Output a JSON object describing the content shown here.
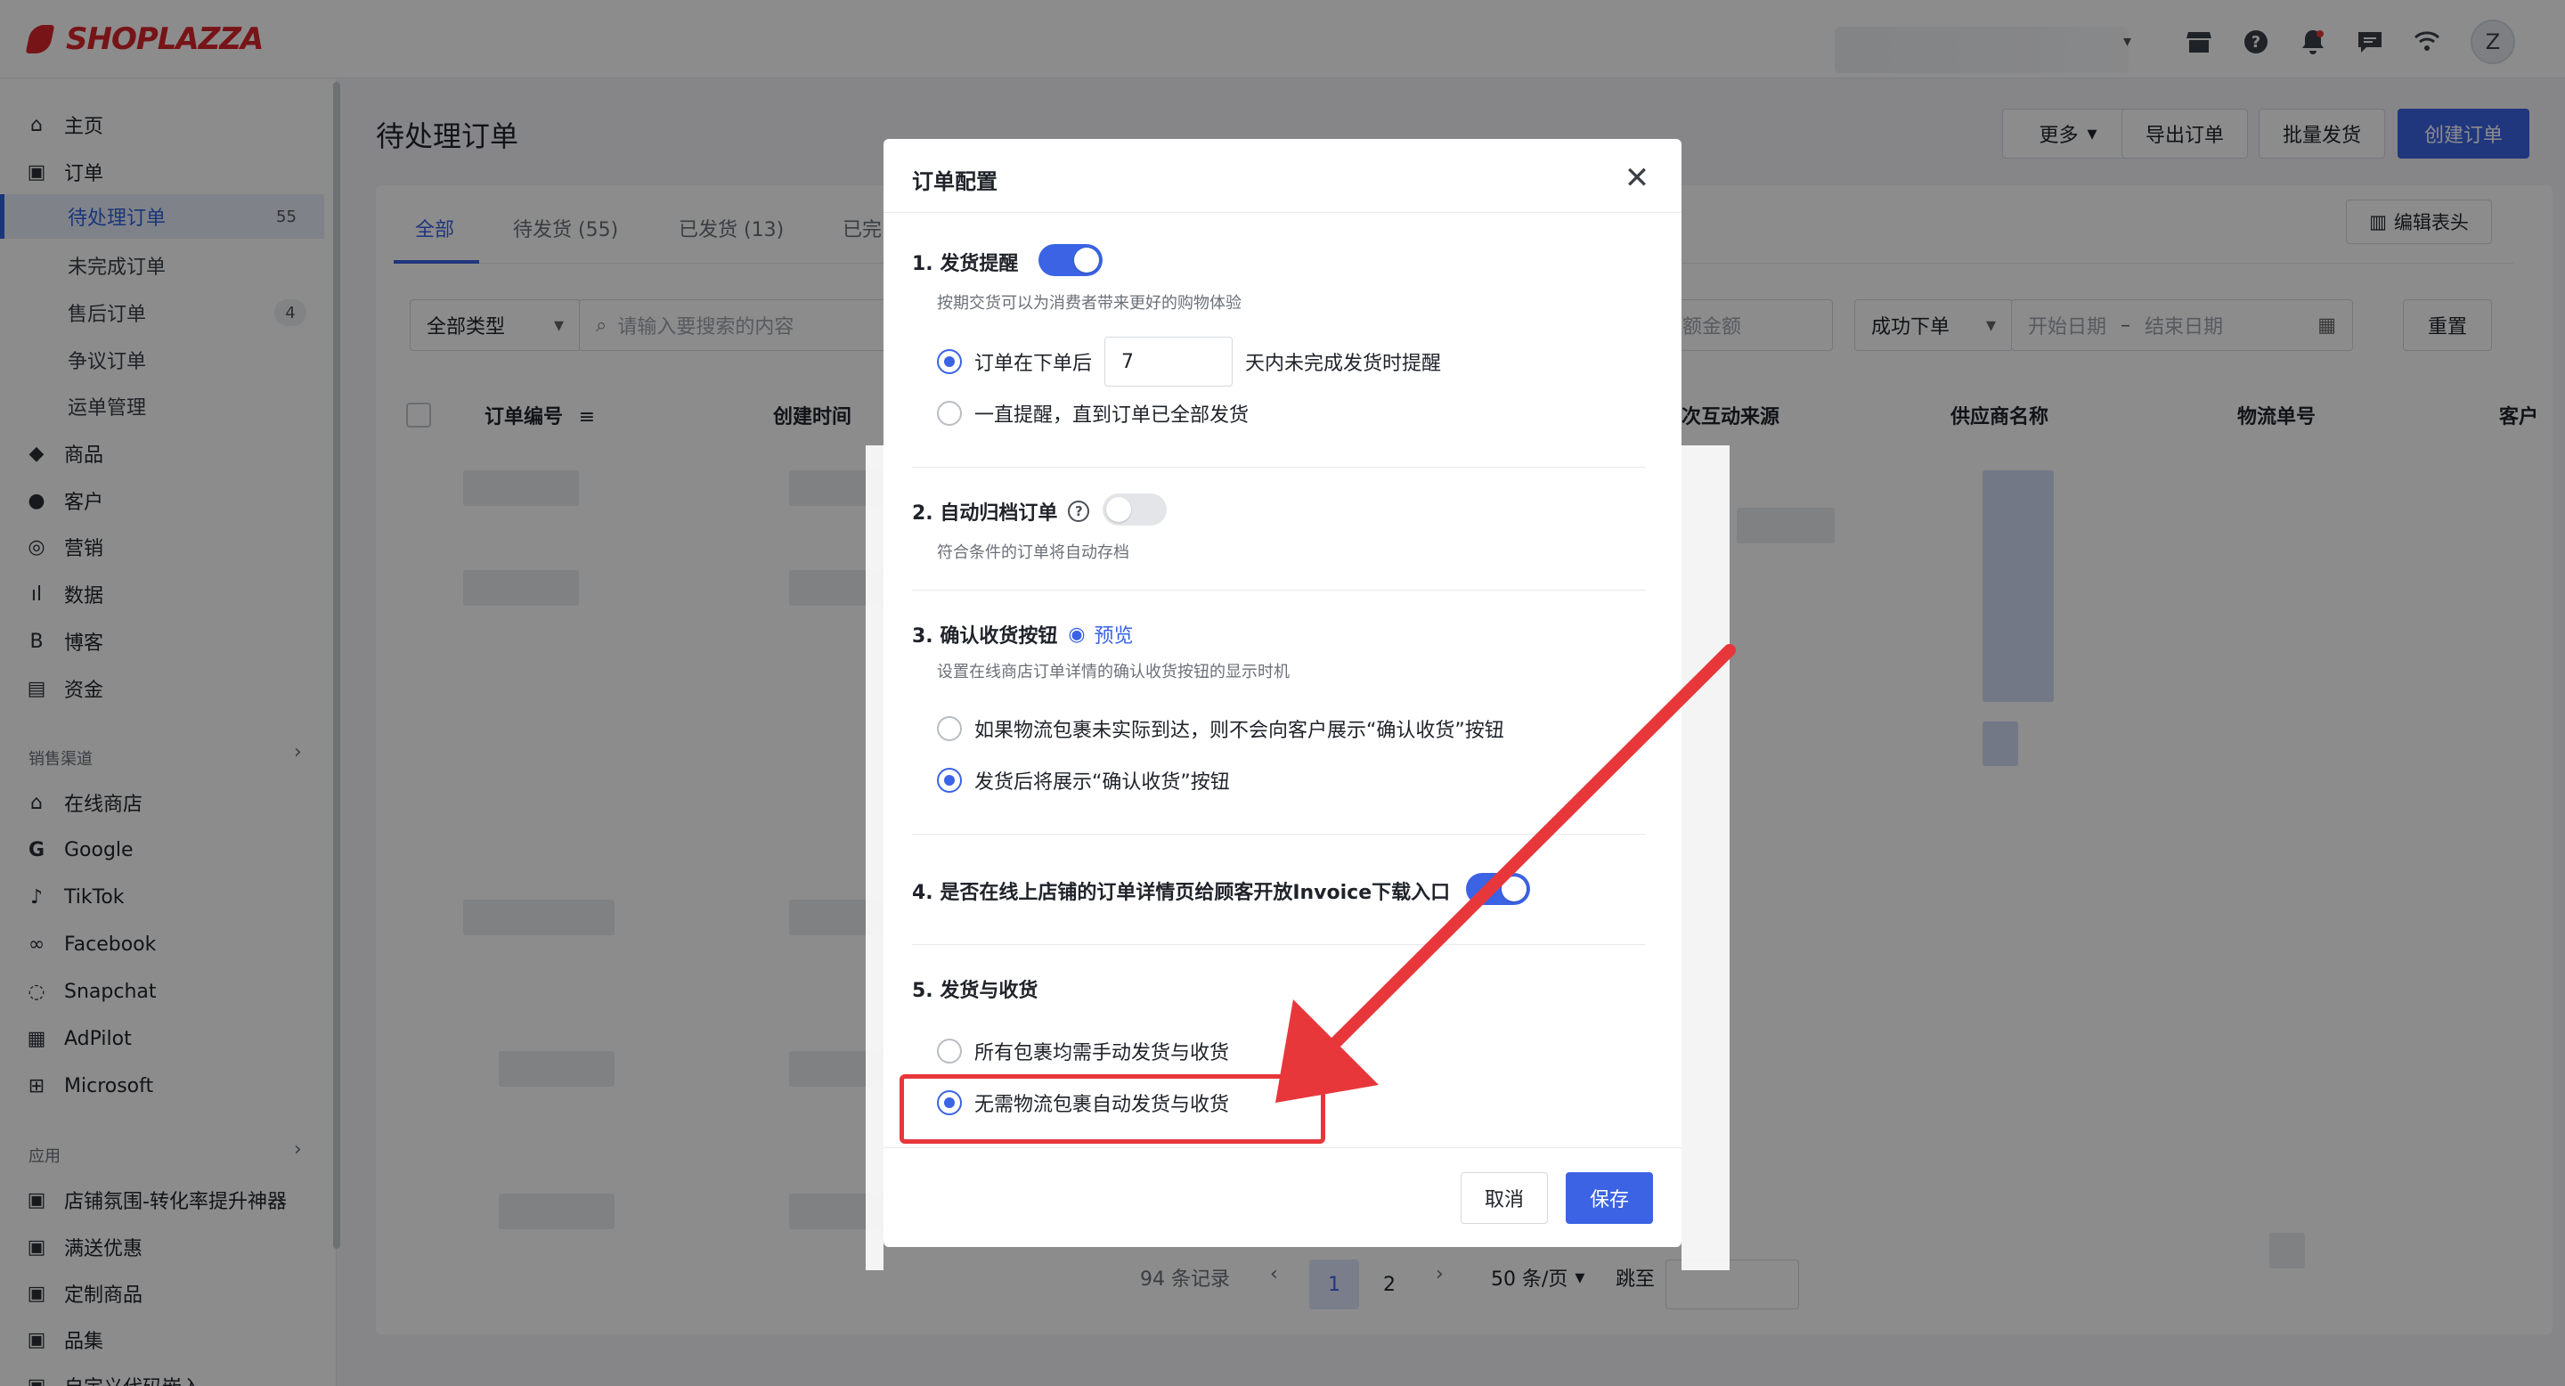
{
  "brand": {
    "logo_text": "SHOPLAZZA",
    "color": "#d9252b"
  },
  "topbar": {
    "icons": [
      "store-icon",
      "help-icon",
      "bell-icon",
      "chat-icon",
      "wifi-icon"
    ],
    "avatar_letter": "Z"
  },
  "sidebar": {
    "items": [
      {
        "label": "主页",
        "icon": "home-icon"
      },
      {
        "label": "订单",
        "icon": "orders-icon"
      },
      {
        "label": "商品",
        "icon": "tag-icon"
      },
      {
        "label": "客户",
        "icon": "user-icon"
      },
      {
        "label": "营销",
        "icon": "marketing-icon"
      },
      {
        "label": "数据",
        "icon": "chart-icon"
      },
      {
        "label": "博客",
        "icon": "blog-icon"
      },
      {
        "label": "资金",
        "icon": "wallet-icon"
      }
    ],
    "order_subitems": [
      {
        "label": "待处理订单",
        "badge": "55"
      },
      {
        "label": "未完成订单",
        "badge": ""
      },
      {
        "label": "售后订单",
        "badge": "4"
      },
      {
        "label": "争议订单",
        "badge": ""
      },
      {
        "label": "运单管理",
        "badge": ""
      }
    ],
    "channels_label": "销售渠道",
    "channels": [
      {
        "label": "在线商店",
        "icon": "storefront-icon"
      },
      {
        "label": "Google",
        "icon": "google-icon"
      },
      {
        "label": "TikTok",
        "icon": "tiktok-icon"
      },
      {
        "label": "Facebook",
        "icon": "meta-icon"
      },
      {
        "label": "Snapchat",
        "icon": "snapchat-icon"
      },
      {
        "label": "AdPilot",
        "icon": "adpilot-icon"
      },
      {
        "label": "Microsoft",
        "icon": "microsoft-icon"
      }
    ],
    "apps_label": "应用",
    "apps": [
      {
        "label": "店铺氛围-转化率提升神器",
        "icon": "app-icon"
      },
      {
        "label": "满送优惠",
        "icon": "app-icon"
      },
      {
        "label": "定制商品",
        "icon": "app-icon"
      },
      {
        "label": "品集",
        "icon": "app-icon"
      },
      {
        "label": "自定义代码嵌入",
        "icon": "app-icon"
      }
    ]
  },
  "main": {
    "title": "待处理订单",
    "actions": {
      "more": "更多",
      "export": "导出订单",
      "batch_ship": "批量发货",
      "create": "创建订单"
    },
    "tabs": [
      "全部",
      "待发货 (55)",
      "已发货 (13)",
      "已完"
    ],
    "edit_columns": "编辑表头",
    "filters": {
      "type": "全部类型",
      "search_placeholder": "请输入要搜索的内容",
      "amount_placeholder": "额金额",
      "status": "成功下单",
      "start_date": "开始日期",
      "end_date": "结束日期",
      "reset": "重置"
    },
    "columns": [
      "订单编号",
      "创建时间",
      "次互动来源",
      "供应商名称",
      "物流单号",
      "客户"
    ],
    "pagination": {
      "total": "94 条记录",
      "pages": [
        "1",
        "2"
      ],
      "page_size": "50 条/页",
      "jump": "跳至"
    }
  },
  "dialog": {
    "title": "订单配置",
    "s1": {
      "title": "1. 发货提醒",
      "toggle_on": true,
      "desc": "按期交货可以为消费者带来更好的购物体验",
      "opt1_prefix": "订单在下单后",
      "days_value": "7",
      "opt1_suffix": "天内未完成发货时提醒",
      "opt2": "一直提醒，直到订单已全部发货"
    },
    "s2": {
      "title": "2. 自动归档订单",
      "toggle_on": false,
      "desc": "符合条件的订单将自动存档"
    },
    "s3": {
      "title": "3. 确认收货按钮",
      "preview": "预览",
      "desc": "设置在线商店订单详情的确认收货按钮的显示时机",
      "opt1": "如果物流包裹未实际到达，则不会向客户展示“确认收货”按钮",
      "opt2": "发货后将展示“确认收货”按钮"
    },
    "s4": {
      "title": "4. 是否在线上店铺的订单详情页给顾客开放Invoice下载入口",
      "toggle_on": true
    },
    "s5": {
      "title": "5. 发货与收货",
      "opt1": "所有包裹均需手动发货与收货",
      "opt2": "无需物流包裹自动发货与收货"
    },
    "cancel": "取消",
    "save": "保存"
  },
  "colors": {
    "accent": "#3b63e4",
    "annotation": "#e8373b"
  }
}
